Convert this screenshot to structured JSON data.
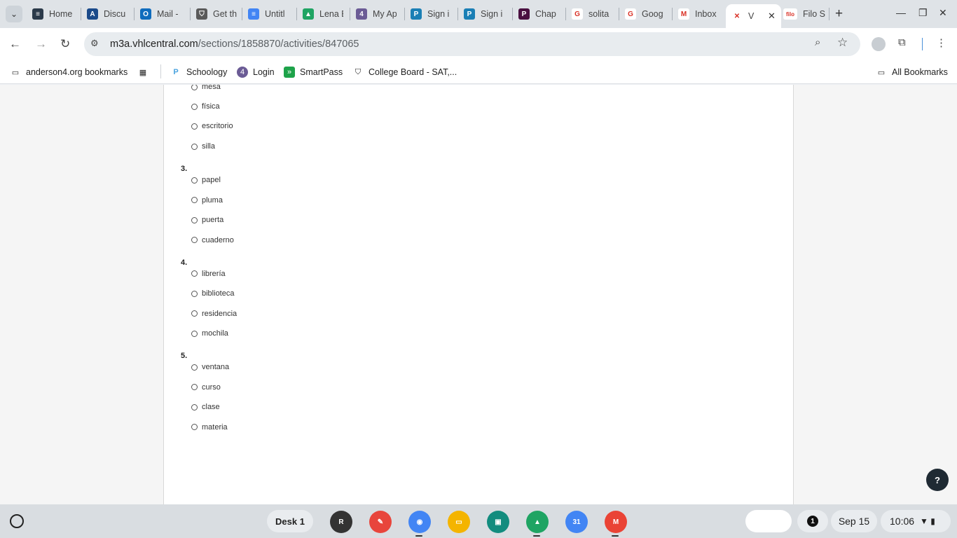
{
  "browser": {
    "tabs": [
      {
        "title": "Home",
        "icon": "tabs-icon",
        "color": "#2b3a4a",
        "glyph": "≡"
      },
      {
        "title": "Discu",
        "icon": "canvas-a-icon",
        "color": "#1a4a8a",
        "glyph": "A"
      },
      {
        "title": "Mail -",
        "icon": "outlook-icon",
        "color": "#0f6cbd",
        "glyph": "O"
      },
      {
        "title": "Get th",
        "icon": "shield-icon",
        "color": "#5a5a5a",
        "glyph": "⛉"
      },
      {
        "title": "Untitl",
        "icon": "docs-icon",
        "color": "#4285f4",
        "glyph": "≡"
      },
      {
        "title": "Lena E",
        "icon": "drive-icon",
        "color": "#1fa463",
        "glyph": "▲"
      },
      {
        "title": "My Ap",
        "icon": "loop-icon",
        "color": "#6b5b95",
        "glyph": "4"
      },
      {
        "title": "Sign i",
        "icon": "p-icon",
        "color": "#1a7fb5",
        "glyph": "P"
      },
      {
        "title": "Sign i",
        "icon": "p-icon",
        "color": "#1a7fb5",
        "glyph": "P"
      },
      {
        "title": "Chap",
        "icon": "p-dark-icon",
        "color": "#4a1040",
        "glyph": "P"
      },
      {
        "title": "solita",
        "icon": "google-icon",
        "color": "#ffffff",
        "glyph": "G"
      },
      {
        "title": "Goog",
        "icon": "google-icon",
        "color": "#ffffff",
        "glyph": "G"
      },
      {
        "title": "Inbox",
        "icon": "gmail-icon",
        "color": "#ffffff",
        "glyph": "M"
      },
      {
        "title": "V",
        "icon": "vhl-icon",
        "color": "#ffffff",
        "glyph": "✕",
        "active": true
      },
      {
        "title": "Filo S",
        "icon": "filo-icon",
        "color": "#ffffff",
        "glyph": "filo"
      }
    ],
    "url_host": "m3a.vhlcentral.com",
    "url_path": "/sections/1858870/activities/847065"
  },
  "bookmarks": {
    "items": [
      {
        "label": "anderson4.org bookmarks"
      },
      {
        "label": "Schoology"
      },
      {
        "label": "Login"
      },
      {
        "label": "SmartPass"
      },
      {
        "label": "College Board - SAT,..."
      }
    ],
    "all_label": "All Bookmarks"
  },
  "quiz": {
    "q2_partial_options": [
      "mesa",
      "física",
      "escritorio",
      "silla"
    ],
    "questions": [
      {
        "number": "3.",
        "options": [
          "papel",
          "pluma",
          "puerta",
          "cuaderno"
        ]
      },
      {
        "number": "4.",
        "options": [
          "librería",
          "biblioteca",
          "residencia",
          "mochila"
        ]
      },
      {
        "number": "5.",
        "options": [
          "ventana",
          "curso",
          "clase",
          "materia"
        ]
      }
    ]
  },
  "shelf": {
    "desk_label": "Desk 1",
    "apps": [
      {
        "name": "r-app-icon",
        "glyph": "R",
        "color": "#333333"
      },
      {
        "name": "paint-app-icon",
        "glyph": "✎",
        "color": "#e8453c"
      },
      {
        "name": "chrome-icon",
        "glyph": "◉",
        "color": "#4285f4"
      },
      {
        "name": "slides-icon",
        "glyph": "▭",
        "color": "#f4b400"
      },
      {
        "name": "classroom-icon",
        "glyph": "▣",
        "color": "#128c7e"
      },
      {
        "name": "drive-icon",
        "glyph": "▲",
        "color": "#1fa463"
      },
      {
        "name": "calendar-icon",
        "glyph": "31",
        "color": "#4285f4"
      },
      {
        "name": "gmail-icon",
        "glyph": "M",
        "color": "#ea4335"
      }
    ],
    "notification_count": "1",
    "date": "Sep 15",
    "time": "10:06"
  }
}
